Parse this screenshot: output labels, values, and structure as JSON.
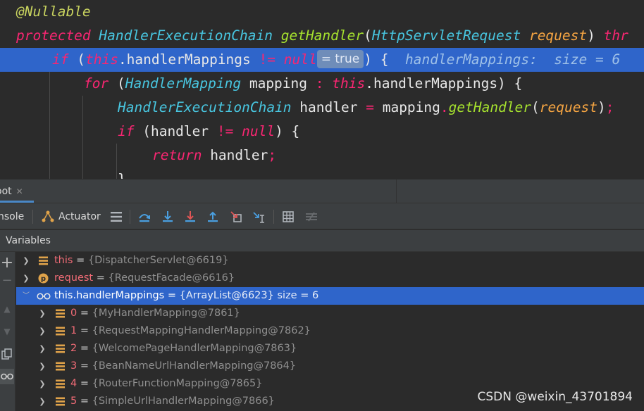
{
  "editor": {
    "line1": {
      "annotation": "@Nullable"
    },
    "line2": {
      "kw_protected": "protected",
      "return_type": "HandlerExecutionChain",
      "method": "getHandler",
      "paren_open": "(",
      "param_type": "HttpServletRequest",
      "param_name": "request",
      "paren_close": ")",
      "kw_throws": "thr"
    },
    "line3": {
      "kw_if": "if",
      "open": " (",
      "kw_this": "this",
      "field": ".handlerMappings ",
      "neq": "!=",
      "kw_null": " null",
      "inlay": "= true",
      "close": ") {",
      "hint": "handlerMappings:  size = 6"
    },
    "line4": {
      "kw_for": "for",
      "open": " (",
      "type": "HandlerMapping",
      "var": " mapping ",
      "colon": ":",
      "kw_this": " this",
      "field": ".handlerMappings) {"
    },
    "line5": {
      "type": "HandlerExecutionChain",
      "var": " handler ",
      "eq": "=",
      "obj": " mapping",
      "dot": ".",
      "call": "getHandler",
      "open": "(",
      "arg": "request",
      "close": ")",
      "semi": ";"
    },
    "line6": {
      "kw_if": "if",
      "open": " (handler ",
      "neq": "!=",
      "kw_null": " null",
      "close": ") {"
    },
    "line7": {
      "kw_return": "return",
      "var": " handler",
      "semi": ";"
    },
    "line8": {
      "text": "}"
    }
  },
  "debug": {
    "tab_label": "oot",
    "tab_close": "✕",
    "toolbar": {
      "console_label": "nsole",
      "actuator_label": "Actuator"
    },
    "variables_title": "Variables",
    "variables": [
      {
        "name": "this",
        "eq": " = ",
        "value": "{DispatcherServlet@6619}",
        "icon": "field-icon",
        "expanded": false
      },
      {
        "name": "request",
        "eq": " = ",
        "value": "{RequestFacade@6616}",
        "icon": "parameter-icon",
        "expanded": false
      },
      {
        "name": "this.handlerMappings",
        "eq": " = ",
        "value": "{ArrayList@6623}",
        "size": "  size = 6",
        "icon": "watch-icon",
        "expanded": true,
        "selected": true
      }
    ],
    "children": [
      {
        "name": "0",
        "eq": " = ",
        "value": "{MyHandlerMapping@7861}"
      },
      {
        "name": "1",
        "eq": " = ",
        "value": "{RequestMappingHandlerMapping@7862}"
      },
      {
        "name": "2",
        "eq": " = ",
        "value": "{WelcomePageHandlerMapping@7863}"
      },
      {
        "name": "3",
        "eq": " = ",
        "value": "{BeanNameUrlHandlerMapping@7864}"
      },
      {
        "name": "4",
        "eq": " = ",
        "value": "{RouterFunctionMapping@7865}"
      },
      {
        "name": "5",
        "eq": " = ",
        "value": "{SimpleUrlHandlerMapping@7866}"
      }
    ]
  },
  "watermark": "CSDN @weixin_43701894",
  "colors": {
    "keyword": "#f92672",
    "type": "#48c6e0",
    "method": "#a6e22e",
    "parameter": "#f6a542",
    "annotation": "#c8d35f",
    "selection": "#2f65ca",
    "variable_name": "#f06b76"
  }
}
